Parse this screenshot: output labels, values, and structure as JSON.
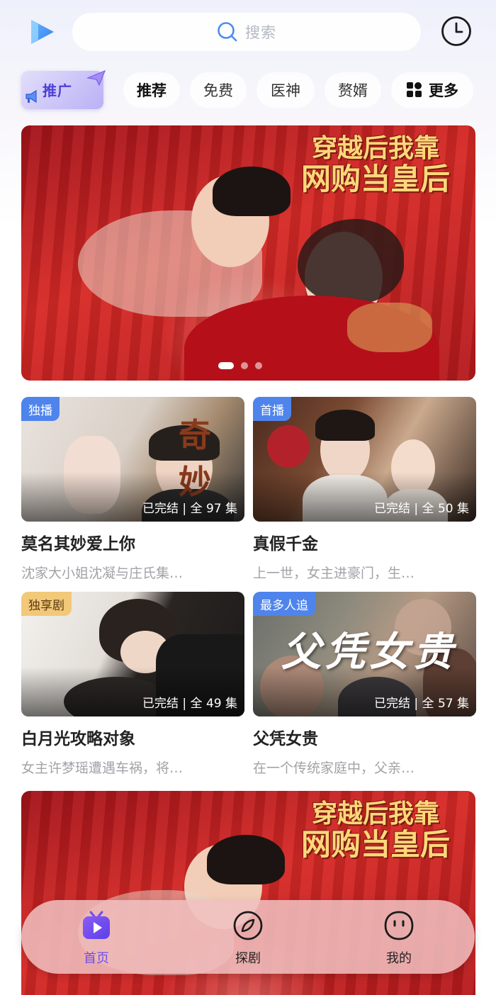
{
  "search": {
    "placeholder": "搜索"
  },
  "tabs": {
    "promo": "推广",
    "items": [
      "推荐",
      "免费",
      "医神",
      "赘婿"
    ],
    "more": "更多"
  },
  "banner": {
    "title_line1": "穿越后我靠",
    "title_line2": "网购当皇后",
    "slide_count": 3,
    "active_slide": 1
  },
  "dramas": [
    {
      "badge": "独播",
      "status": "已完结 | 全 97 集",
      "title": "莫名其妙爱上你",
      "desc": "沈家大小姐沈凝与庄氏集…",
      "art_text": "奇 妙"
    },
    {
      "badge": "首播",
      "status": "已完结 | 全 50 集",
      "title": "真假千金",
      "desc": "上一世，女主进豪门，生…"
    },
    {
      "badge": "独享剧",
      "status": "已完结 | 全 49 集",
      "title": "白月光攻略对象",
      "desc": "女主许梦瑶遭遇车祸，将…"
    },
    {
      "badge": "最多人追",
      "status": "已完结 | 全 57 集",
      "title": "父凭女贵",
      "desc": "在一个传统家庭中，父亲…",
      "art_text": "父凭女贵"
    }
  ],
  "banner2": {
    "title_line1": "穿越后我靠",
    "title_line2": "网购当皇后"
  },
  "bottom_nav": [
    {
      "label": "首页",
      "icon": "tv-play-icon",
      "active": true
    },
    {
      "label": "探剧",
      "icon": "compass-icon",
      "active": false
    },
    {
      "label": "我的",
      "icon": "profile-face-icon",
      "active": false
    }
  ],
  "colors": {
    "accent": "#6a4ef0",
    "badge_blue": "#4e84ec",
    "badge_gold": "#f2c879",
    "banner_red": "#c8201f"
  }
}
